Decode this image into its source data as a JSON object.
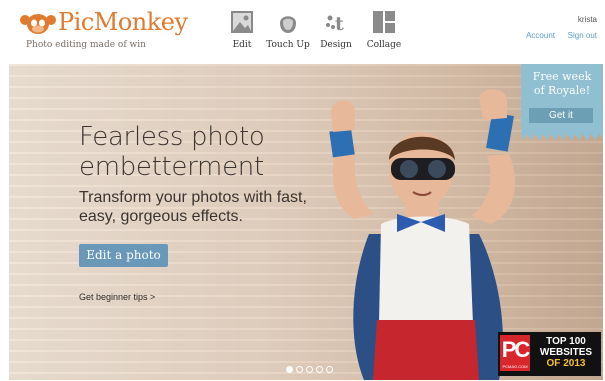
{
  "brand": {
    "name": "PicMonkey",
    "tagline": "Photo editing made of win",
    "color": "#e07a2e"
  },
  "nav": {
    "items": [
      {
        "label": "Edit",
        "icon": "image-icon"
      },
      {
        "label": "Touch Up",
        "icon": "face-icon"
      },
      {
        "label": "Design",
        "icon": "design-icon"
      },
      {
        "label": "Collage",
        "icon": "collage-icon"
      }
    ]
  },
  "account": {
    "user": "krista",
    "account_label": "Account",
    "signout_label": "Sign out"
  },
  "hero": {
    "title_line1": "Fearless photo",
    "title_line2": "embetterment",
    "subtitle": "Transform your photos with fast, easy, gorgeous effects.",
    "cta_label": "Edit a photo",
    "tips_label": "Get beginner tips >",
    "accent": "#6a98b8"
  },
  "promo": {
    "line1": "Free week",
    "line2": "of Royale!",
    "button_label": "Get it"
  },
  "badge": {
    "logo": "PC",
    "logo_sub": "PCMAG.COM",
    "line1": "TOP 100",
    "line2": "WEBSITES",
    "line3": "OF 2013"
  },
  "carousel": {
    "count": 5,
    "active": 0
  }
}
